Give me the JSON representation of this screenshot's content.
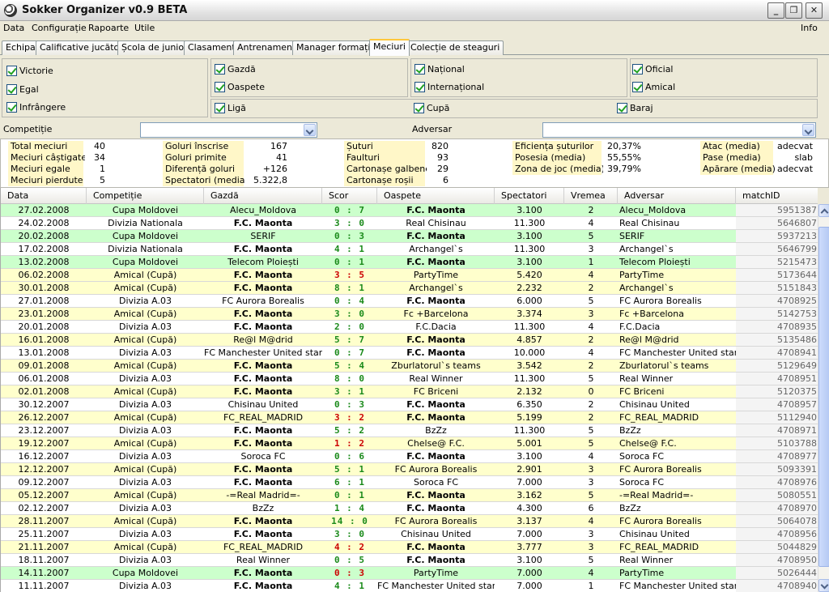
{
  "window": {
    "title": "Sokker Organizer v0.9 BETA"
  },
  "menu": {
    "items": [
      "Data",
      "Configurație",
      "Rapoarte",
      "Utile"
    ],
    "help": "Info"
  },
  "tabs": [
    {
      "label": "Echipa",
      "active": false
    },
    {
      "label": "Calificative jucători",
      "active": false
    },
    {
      "label": "Școla de juniori",
      "active": false
    },
    {
      "label": "Clasament",
      "active": false
    },
    {
      "label": "Antrenament",
      "active": false
    },
    {
      "label": "Manager formație",
      "active": false
    },
    {
      "label": "Meciuri",
      "active": true
    },
    {
      "label": "Colecție de steaguri",
      "active": false
    }
  ],
  "filters": {
    "result": [
      "Victorie",
      "Egal",
      "Infrângere"
    ],
    "venue": [
      "Gazdă",
      "Oaspete"
    ],
    "scope": [
      "Național",
      "Internațional"
    ],
    "type": [
      "Oficial",
      "Amical"
    ],
    "competition_type": [
      "Ligă",
      "Cupă",
      "Baraj"
    ]
  },
  "competition": {
    "label": "Competiție",
    "value": ""
  },
  "opponent": {
    "label": "Adversar",
    "value": ""
  },
  "stats": {
    "g1": [
      [
        "Total meciuri",
        "40"
      ],
      [
        "Meciuri câștigate",
        "34"
      ],
      [
        "Meciuri egale",
        "1"
      ],
      [
        "Meciuri pierdute",
        "5"
      ]
    ],
    "g2": [
      [
        "Goluri înscrise",
        "167"
      ],
      [
        "Goluri primite",
        "41"
      ],
      [
        "Diferență goluri",
        "+126"
      ],
      [
        "Spectatori (media)",
        "5.322,8"
      ]
    ],
    "g3": [
      [
        "Șuturi",
        "820"
      ],
      [
        "Faulturi",
        "93"
      ],
      [
        "Cartonașe galbene",
        "29"
      ],
      [
        "Cartonașe roșii",
        "6"
      ]
    ],
    "g4": [
      [
        "Eficiența șuturilor",
        "20,37%"
      ],
      [
        "Posesia (media)",
        "55,55%"
      ],
      [
        "Zona de joc (media)",
        "39,79%"
      ]
    ],
    "g5": [
      [
        "Atac (media)",
        "adecvat"
      ],
      [
        "Pase (media)",
        "slab"
      ],
      [
        "Apărare (media)",
        "adecvat"
      ]
    ]
  },
  "table": {
    "columns": [
      "Data",
      "Competiție",
      "Gazdă",
      "Scor",
      "Oaspete",
      "Spectatori",
      "Vremea",
      "Adversar",
      "matchID"
    ],
    "colors": {
      "cup": "#ccffcc",
      "friendly": "#ffffcc",
      "league": "#ffffff",
      "win": "#1a8a1a",
      "loss": "#cc0000"
    },
    "rows": [
      [
        "27.02.2008",
        "Cupa Moldovei",
        "Alecu_Moldova",
        "0 : 7",
        "F.C. Maonta",
        "3.100",
        "2",
        "Alecu_Moldova",
        "5951387",
        "cup",
        "away",
        "win"
      ],
      [
        "24.02.2008",
        "Divizia Nationala",
        "F.C. Maonta",
        "3 : 0",
        "Real Chisinau",
        "11.300",
        "4",
        "Real Chisinau",
        "5646807",
        "league",
        "home",
        "win"
      ],
      [
        "20.02.2008",
        "Cupa Moldovei",
        "SERIF",
        "0 : 3",
        "F.C. Maonta",
        "3.100",
        "5",
        "SERIF",
        "5937213",
        "cup",
        "away",
        "win"
      ],
      [
        "17.02.2008",
        "Divizia Nationala",
        "F.C. Maonta",
        "4 : 1",
        "Archangel`s",
        "11.300",
        "3",
        "Archangel`s",
        "5646799",
        "league",
        "home",
        "win"
      ],
      [
        "13.02.2008",
        "Cupa Moldovei",
        "Telecom Ploiești",
        "0 : 1",
        "F.C. Maonta",
        "3.100",
        "1",
        "Telecom Ploiești",
        "5215473",
        "cup",
        "away",
        "win"
      ],
      [
        "06.02.2008",
        "Amical (Cupă)",
        "F.C. Maonta",
        "3 : 5",
        "PartyTime",
        "5.420",
        "4",
        "PartyTime",
        "5173644",
        "friendly",
        "away",
        "loss"
      ],
      [
        "30.01.2008",
        "Amical (Cupă)",
        "F.C. Maonta",
        "8 : 1",
        "Archangel`s",
        "2.232",
        "2",
        "Archangel`s",
        "5151843",
        "friendly",
        "home",
        "win"
      ],
      [
        "27.01.2008",
        "Divizia A.03",
        "FC Aurora Borealis",
        "0 : 4",
        "F.C. Maonta",
        "6.000",
        "5",
        "FC Aurora Borealis",
        "4708925",
        "league",
        "away",
        "win"
      ],
      [
        "23.01.2008",
        "Amical (Cupă)",
        "F.C. Maonta",
        "3 : 0",
        "Fc +Barcelona",
        "3.374",
        "3",
        "Fc +Barcelona",
        "5142753",
        "friendly",
        "home",
        "win"
      ],
      [
        "20.01.2008",
        "Divizia A.03",
        "F.C. Maonta",
        "2 : 0",
        "F.C.Dacia",
        "11.300",
        "4",
        "F.C.Dacia",
        "4708935",
        "league",
        "home",
        "win"
      ],
      [
        "16.01.2008",
        "Amical (Cupă)",
        "Re@l M@drid",
        "5 : 7",
        "F.C. Maonta",
        "4.857",
        "2",
        "Re@l M@drid",
        "5135486",
        "friendly",
        "away",
        "win"
      ],
      [
        "13.01.2008",
        "Divizia A.03",
        "FC Manchester United stars",
        "0 : 7",
        "F.C. Maonta",
        "10.000",
        "4",
        "FC Manchester United stars",
        "4708941",
        "league",
        "away",
        "win"
      ],
      [
        "09.01.2008",
        "Amical (Cupă)",
        "F.C. Maonta",
        "5 : 4",
        "Zburlatorul`s teams",
        "3.542",
        "2",
        "Zburlatorul`s teams",
        "5129649",
        "friendly",
        "home",
        "win"
      ],
      [
        "06.01.2008",
        "Divizia A.03",
        "F.C. Maonta",
        "8 : 0",
        "Real Winner",
        "11.300",
        "5",
        "Real Winner",
        "4708951",
        "league",
        "home",
        "win"
      ],
      [
        "02.01.2008",
        "Amical (Cupă)",
        "F.C. Maonta",
        "3 : 1",
        "FC Briceni",
        "2.132",
        "0",
        "FC Briceni",
        "5120375",
        "friendly",
        "home",
        "win"
      ],
      [
        "30.12.2007",
        "Divizia A.03",
        "Chisinau United",
        "0 : 3",
        "F.C. Maonta",
        "6.350",
        "2",
        "Chisinau United",
        "4708957",
        "league",
        "away",
        "win"
      ],
      [
        "26.12.2007",
        "Amical (Cupă)",
        "FC_REAL_MADRID",
        "3 : 2",
        "F.C. Maonta",
        "5.199",
        "2",
        "FC_REAL_MADRID",
        "5112940",
        "friendly",
        "away",
        "loss"
      ],
      [
        "23.12.2007",
        "Divizia A.03",
        "F.C. Maonta",
        "5 : 2",
        "BzZz",
        "11.300",
        "5",
        "BzZz",
        "4708971",
        "league",
        "home",
        "win"
      ],
      [
        "19.12.2007",
        "Amical (Cupă)",
        "F.C. Maonta",
        "1 : 2",
        "Chelse@ F.C.",
        "5.001",
        "5",
        "Chelse@ F.C.",
        "5103788",
        "friendly",
        "away",
        "loss"
      ],
      [
        "16.12.2007",
        "Divizia A.03",
        "Soroca FC",
        "0 : 6",
        "F.C. Maonta",
        "3.100",
        "4",
        "Soroca FC",
        "4708977",
        "league",
        "away",
        "win"
      ],
      [
        "12.12.2007",
        "Amical (Cupă)",
        "F.C. Maonta",
        "5 : 1",
        "FC Aurora Borealis",
        "2.901",
        "3",
        "FC Aurora Borealis",
        "5093391",
        "friendly",
        "home",
        "win"
      ],
      [
        "09.12.2007",
        "Divizia A.03",
        "F.C. Maonta",
        "6 : 1",
        "Soroca FC",
        "7.000",
        "3",
        "Soroca FC",
        "4708976",
        "league",
        "home",
        "win"
      ],
      [
        "05.12.2007",
        "Amical (Cupă)",
        "-=Real Madrid=-",
        "0 : 1",
        "F.C. Maonta",
        "3.162",
        "5",
        "-=Real Madrid=-",
        "5080551",
        "friendly",
        "away",
        "win"
      ],
      [
        "02.12.2007",
        "Divizia A.03",
        "BzZz",
        "1 : 4",
        "F.C. Maonta",
        "4.300",
        "6",
        "BzZz",
        "4708970",
        "league",
        "away",
        "win"
      ],
      [
        "28.11.2007",
        "Amical (Cupă)",
        "F.C. Maonta",
        "14 : 0",
        "FC Aurora Borealis",
        "3.137",
        "4",
        "FC Aurora Borealis",
        "5064078",
        "friendly",
        "home",
        "win"
      ],
      [
        "25.11.2007",
        "Divizia A.03",
        "F.C. Maonta",
        "3 : 0",
        "Chisinau United",
        "7.000",
        "3",
        "Chisinau United",
        "4708956",
        "league",
        "home",
        "win"
      ],
      [
        "21.11.2007",
        "Amical (Cupă)",
        "FC_REAL_MADRID",
        "4 : 2",
        "F.C. Maonta",
        "3.777",
        "3",
        "FC_REAL_MADRID",
        "5044829",
        "friendly",
        "away",
        "loss"
      ],
      [
        "18.11.2007",
        "Divizia A.03",
        "Real Winner",
        "0 : 5",
        "F.C. Maonta",
        "3.100",
        "5",
        "Real Winner",
        "4708950",
        "league",
        "away",
        "win"
      ],
      [
        "14.11.2007",
        "Cupa Moldovei",
        "F.C. Maonta",
        "0 : 3",
        "PartyTime",
        "7.000",
        "4",
        "PartyTime",
        "5026444",
        "cup",
        "away",
        "loss"
      ],
      [
        "11.11.2007",
        "Divizia A.03",
        "F.C. Maonta",
        "4 : 1",
        "FC Manchester United stars",
        "7.000",
        "1",
        "FC Manchester United stars",
        "4708940",
        "league",
        "home",
        "win"
      ]
    ]
  }
}
